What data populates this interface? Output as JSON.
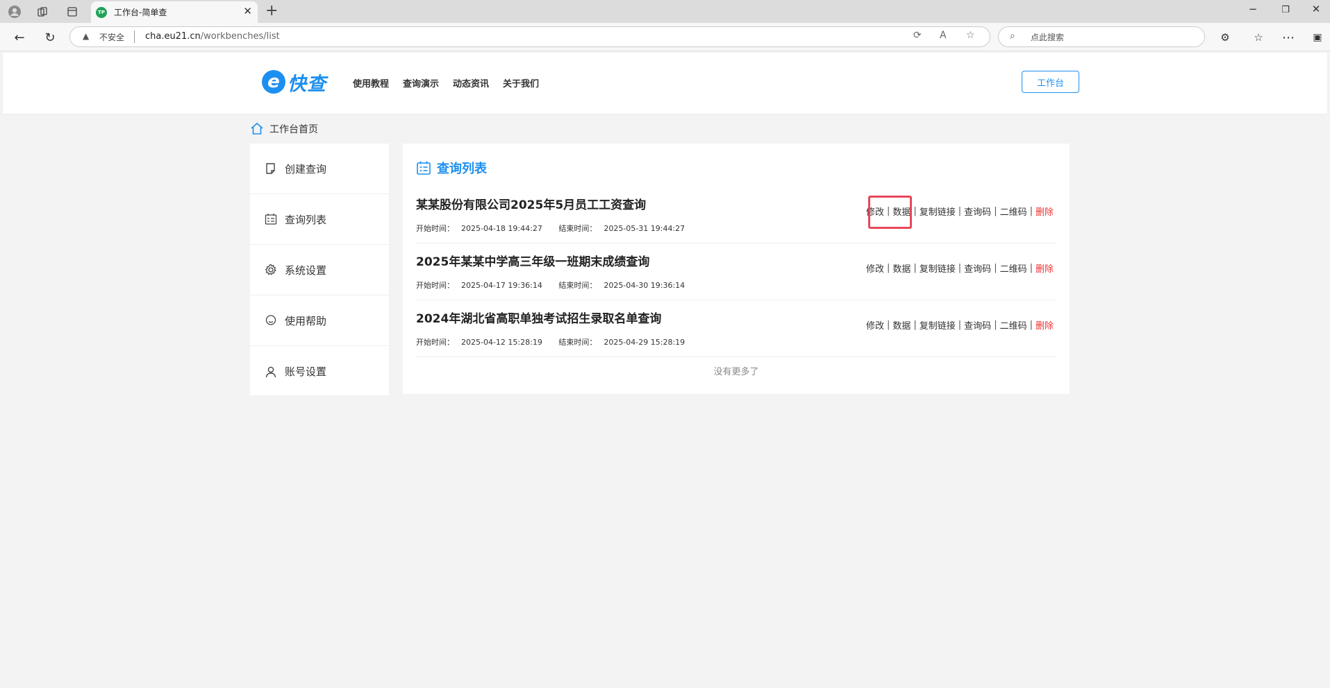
{
  "browser": {
    "tab_favicon": "TP",
    "tab_title": "工作台-简单查",
    "url_insecure": "不安全",
    "url_host": "cha.eu21.cn",
    "url_path": "/workbenches/list",
    "search_placeholder": "点此搜索"
  },
  "header": {
    "logo_text": "快查",
    "logo_e": "e",
    "nav": [
      "使用教程",
      "查询演示",
      "动态资讯",
      "关于我们"
    ],
    "workbench_button": "工作台"
  },
  "breadcrumb": {
    "label": "工作台首页"
  },
  "sidebar": {
    "items": [
      {
        "label": "创建查询",
        "icon": "note-icon"
      },
      {
        "label": "查询列表",
        "icon": "list-icon"
      },
      {
        "label": "系统设置",
        "icon": "gear-icon"
      },
      {
        "label": "使用帮助",
        "icon": "chat-icon"
      },
      {
        "label": "账号设置",
        "icon": "user-icon"
      }
    ]
  },
  "main": {
    "title": "查询列表",
    "queries": [
      {
        "name": "某某股份有限公司2025年5月员工工资查询",
        "start_label": "开始时间：",
        "start": "2025-04-18 19:44:27",
        "end_label": "结束时间：",
        "end": "2025-05-31 19:44:27"
      },
      {
        "name": "2025年某某中学高三年级一班期末成绩查询",
        "start_label": "开始时间：",
        "start": "2025-04-17 19:36:14",
        "end_label": "结束时间：",
        "end": "2025-04-30 19:36:14"
      },
      {
        "name": "2024年湖北省高职单独考试招生录取名单查询",
        "start_label": "开始时间：",
        "start": "2025-04-12 15:28:19",
        "end_label": "结束时间：",
        "end": "2025-04-29 15:28:19"
      }
    ],
    "actions": {
      "edit": "修改",
      "data": "数据",
      "copy_link": "复制链接",
      "query_code": "查询码",
      "qr_code": "二维码",
      "delete": "删除"
    },
    "no_more": "没有更多了"
  },
  "colors": {
    "accent": "#1d8ff0",
    "delete": "#f03232",
    "highlight": "#e8475a"
  }
}
